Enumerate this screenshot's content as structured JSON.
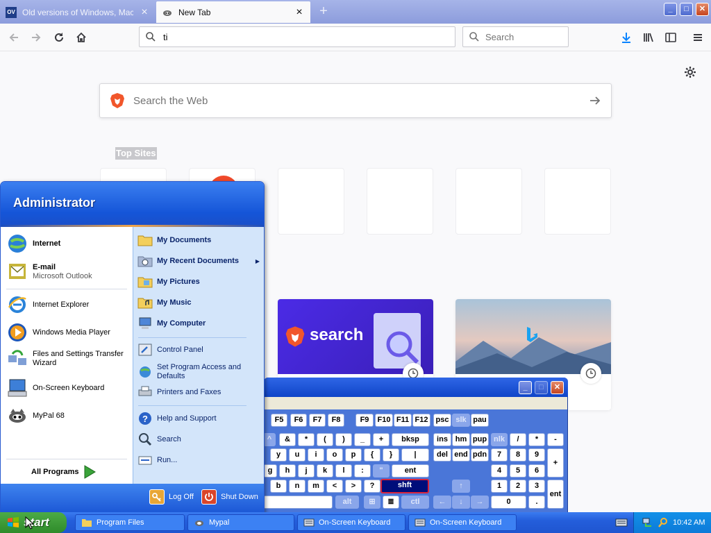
{
  "browser": {
    "tabs": [
      {
        "label": "Old versions of Windows, Mac and",
        "favicon": "OV",
        "active": false
      },
      {
        "label": "New Tab",
        "active": true
      }
    ],
    "url_value": "ti",
    "search_placeholder": "Search",
    "window_buttons": {
      "minimize": "_",
      "maximize": "□",
      "close": "✕"
    }
  },
  "newtab": {
    "websearch_placeholder": "Search the Web",
    "top_sites_title": "Top Sites",
    "cards": [
      {
        "title": "search"
      },
      {
        "title": ""
      }
    ]
  },
  "osk": {
    "rows": [
      [
        {
          "k": "F5"
        },
        {
          "k": "F6"
        },
        {
          "k": "F7"
        },
        {
          "k": "F8"
        },
        {
          "k": "F9"
        },
        {
          "k": "F10"
        },
        {
          "k": "F11"
        },
        {
          "k": "F12"
        },
        {
          "k": "psc"
        },
        {
          "k": "slk",
          "dim": true
        },
        {
          "k": "pau"
        }
      ],
      [
        {
          "k": "^",
          "dim": true
        },
        {
          "k": "&"
        },
        {
          "k": "*"
        },
        {
          "k": "("
        },
        {
          "k": ")"
        },
        {
          "k": "_"
        },
        {
          "k": "+"
        },
        {
          "k": "bksp"
        },
        {
          "k": "ins"
        },
        {
          "k": "hm"
        },
        {
          "k": "pup"
        },
        {
          "k": "nlk",
          "dim": true
        },
        {
          "k": "/"
        },
        {
          "k": "*"
        },
        {
          "k": "-"
        }
      ],
      [
        {
          "k": "y"
        },
        {
          "k": "u"
        },
        {
          "k": "i"
        },
        {
          "k": "o"
        },
        {
          "k": "p"
        },
        {
          "k": "{"
        },
        {
          "k": "}"
        },
        {
          "k": "|"
        },
        {
          "k": "del"
        },
        {
          "k": "end"
        },
        {
          "k": "pdn"
        },
        {
          "k": "7"
        },
        {
          "k": "8"
        },
        {
          "k": "9"
        },
        {
          "k": "+"
        }
      ],
      [
        {
          "k": "g"
        },
        {
          "k": "h"
        },
        {
          "k": "j"
        },
        {
          "k": "k"
        },
        {
          "k": "l"
        },
        {
          "k": ":"
        },
        {
          "k": "\"",
          "dim": true
        },
        {
          "k": "ent"
        },
        {
          "k": "4"
        },
        {
          "k": "5"
        },
        {
          "k": "6"
        }
      ],
      [
        {
          "k": "b"
        },
        {
          "k": "n"
        },
        {
          "k": "m"
        },
        {
          "k": "<"
        },
        {
          "k": ">"
        },
        {
          "k": "?"
        },
        {
          "k": "shft",
          "hl": true
        },
        {
          "k": "↑",
          "dim": true
        },
        {
          "k": "1"
        },
        {
          "k": "2"
        },
        {
          "k": "3"
        },
        {
          "k": "ent"
        }
      ],
      [
        {
          "k": ""
        },
        {
          "k": "alt",
          "dim": true
        },
        {
          "k": "⊞",
          "dim": true
        },
        {
          "k": "≣"
        },
        {
          "k": "ctl",
          "dim": true
        },
        {
          "k": "←",
          "dim": true
        },
        {
          "k": "↓",
          "dim": true
        },
        {
          "k": "→",
          "dim": true
        },
        {
          "k": "0"
        },
        {
          "k": "."
        }
      ]
    ]
  },
  "startmenu": {
    "user": "Administrator",
    "pinned": [
      {
        "label": "Internet",
        "icon": "globe-icon"
      },
      {
        "label": "E-mail",
        "sub": "Microsoft Outlook",
        "icon": "mail-icon"
      }
    ],
    "recent": [
      {
        "label": "Internet Explorer",
        "icon": "ie-icon"
      },
      {
        "label": "Windows Media Player",
        "icon": "media-player-icon"
      },
      {
        "label": "Files and Settings Transfer Wizard",
        "icon": "transfer-wizard-icon"
      },
      {
        "label": "On-Screen Keyboard",
        "icon": "keyboard-icon"
      },
      {
        "label": "MyPal 68",
        "icon": "mypal-icon"
      }
    ],
    "all_programs": "All Programs",
    "places": [
      {
        "label": "My Documents",
        "icon": "folder-icon"
      },
      {
        "label": "My Recent Documents",
        "icon": "recent-docs-icon",
        "arrow": "▶"
      },
      {
        "label": "My Pictures",
        "icon": "pictures-folder-icon"
      },
      {
        "label": "My Music",
        "icon": "music-folder-icon"
      },
      {
        "label": "My Computer",
        "icon": "computer-icon"
      }
    ],
    "settings": [
      {
        "label": "Control Panel",
        "icon": "control-panel-icon"
      },
      {
        "label": "Set Program Access and Defaults",
        "icon": "program-access-icon"
      },
      {
        "label": "Printers and Faxes",
        "icon": "printer-icon"
      }
    ],
    "help": [
      {
        "label": "Help and Support",
        "icon": "help-icon"
      },
      {
        "label": "Search",
        "icon": "search-icon"
      },
      {
        "label": "Run...",
        "icon": "run-icon"
      }
    ],
    "logoff": "Log Off",
    "shutdown": "Shut Down"
  },
  "taskbar": {
    "start_label": "start",
    "buttons": [
      {
        "label": "Program Files",
        "icon": "folder-icon"
      },
      {
        "label": "Mypal",
        "icon": "mypal-icon"
      },
      {
        "label": "On-Screen Keyboard",
        "icon": "keyboard-icon"
      },
      {
        "label": "On-Screen Keyboard",
        "icon": "keyboard-icon"
      }
    ],
    "clock": "10:42 AM"
  },
  "colors": {
    "xp_blue": "#245edb",
    "start_green": "#3c9a34",
    "startmenu_blue": "#1555d8"
  }
}
